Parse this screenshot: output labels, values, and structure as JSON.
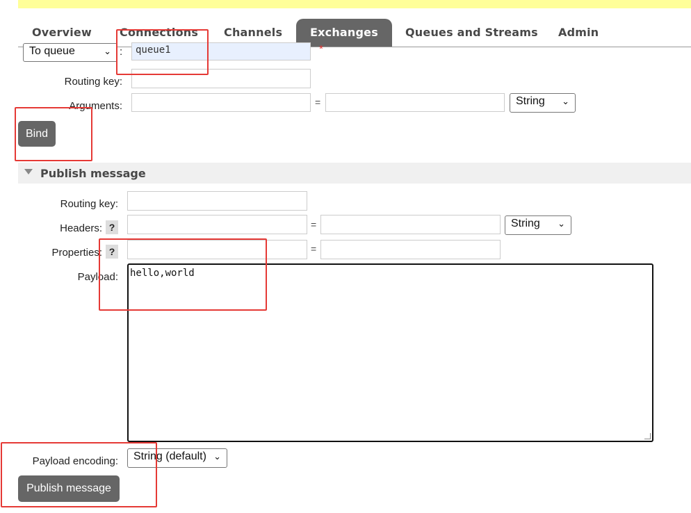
{
  "tabs": [
    {
      "label": "Overview",
      "active": false
    },
    {
      "label": "Connections",
      "active": false
    },
    {
      "label": "Channels",
      "active": false
    },
    {
      "label": "Exchanges",
      "active": true
    },
    {
      "label": "Queues and Streams",
      "active": false
    },
    {
      "label": "Admin",
      "active": false
    }
  ],
  "bind": {
    "destination_type": "To queue",
    "colon": ":",
    "destination_value": "queue1",
    "required_mark": "*",
    "routing_key_label": "Routing key:",
    "routing_key_value": "",
    "arguments_label": "Arguments:",
    "arguments_key": "",
    "equals": "=",
    "arguments_value": "",
    "arguments_type": "String",
    "bind_button": "Bind"
  },
  "publish": {
    "section_title": "Publish message",
    "routing_key_label": "Routing key:",
    "routing_key_value": "",
    "headers_label": "Headers:",
    "help": "?",
    "headers_key": "",
    "headers_value": "",
    "headers_type": "String",
    "properties_label": "Properties:",
    "properties_key": "",
    "properties_value": "",
    "payload_label": "Payload:",
    "payload_value": "hello,world",
    "encoding_label": "Payload encoding:",
    "encoding_value": "String (default)",
    "publish_button": "Publish message"
  },
  "colors": {
    "topbar": "#ffff99",
    "tab_active": "#666666",
    "button": "#666666",
    "highlight": "#e53935"
  }
}
